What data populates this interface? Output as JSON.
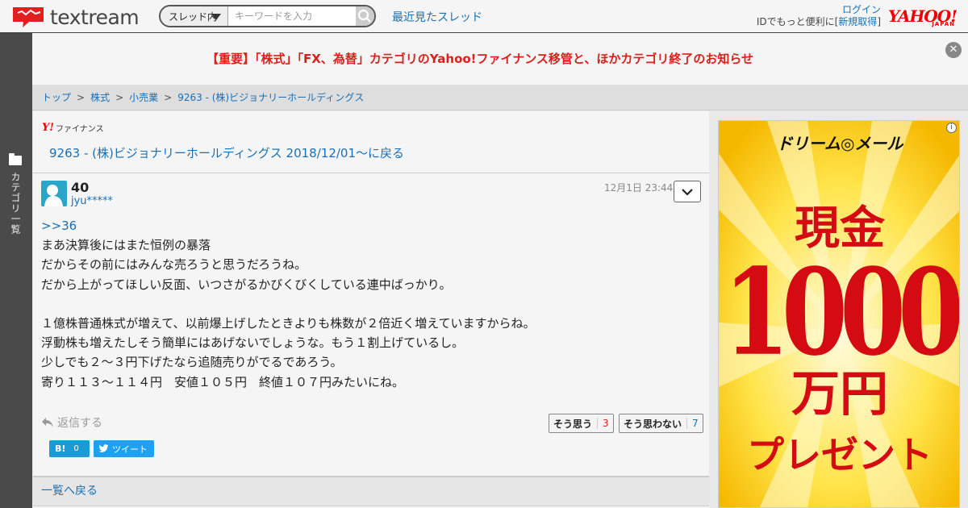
{
  "header": {
    "logo_text": "textream",
    "search_scope": "スレッド内",
    "search_placeholder": "キーワードを入力",
    "recent_threads": "最近見たスレッド",
    "login": "ログイン",
    "login_sub_prefix": "IDでもっと便利に[",
    "register": "新規取得",
    "login_sub_suffix": "]",
    "yahoo_logo": "YAHOO!",
    "yahoo_sub": "JAPAN"
  },
  "sidebar": {
    "category_label": "カテゴリ一覧"
  },
  "notice": {
    "text": "【重要】「株式」「FX、為替」カテゴリのYahoo!ファイナンス移管と、ほかカテゴリ終了のお知らせ"
  },
  "breadcrumb": [
    {
      "label": "トップ"
    },
    {
      "label": "株式"
    },
    {
      "label": "小売業"
    },
    {
      "label": "9263 - (株)ビジョナリーホールディングス"
    }
  ],
  "breadcrumb_sep": ">",
  "main": {
    "yf_logo_y": "Y!",
    "yf_logo_text": "ファイナンス",
    "back_link": "9263 - (株)ビジョナリーホールディングス 2018/12/01〜に戻る"
  },
  "post": {
    "number": "40",
    "user": "jyu*****",
    "time": "12月1日 23:44",
    "reply_ref": ">>36",
    "lines": [
      "まあ決算後にはまた恒例の暴落",
      "だからその前にはみんな売ろうと思うだろうね。",
      "だから上がってほしい反面、いつさがるかびくびくしている連中ばっかり。",
      "",
      "１億株普通株式が増えて、以前爆上げしたときよりも株数が２倍近く増えていますからね。",
      "浮動株も増えたしそう簡単にはあげないでしょうな。もう１割上げているし。",
      "少しでも２～３円下げたなら追随売りがでるであろう。",
      "寄り１１３～１１４円　安値１０５円　終値１０７円みたいにね。"
    ],
    "reply_label": "返信する",
    "vote_yes_label": "そう思う",
    "vote_yes_count": "3",
    "vote_no_label": "そう思わない",
    "vote_no_count": "7"
  },
  "share": {
    "hatena_label": "B!",
    "hatena_count": "0",
    "tweet_label": "ツイート"
  },
  "list_back": "一覧へ戻る",
  "ad": {
    "brand": "ドリーム◎メール",
    "line1": "現金",
    "line2": "1000",
    "line3": "万円",
    "line4": "プレゼント"
  }
}
